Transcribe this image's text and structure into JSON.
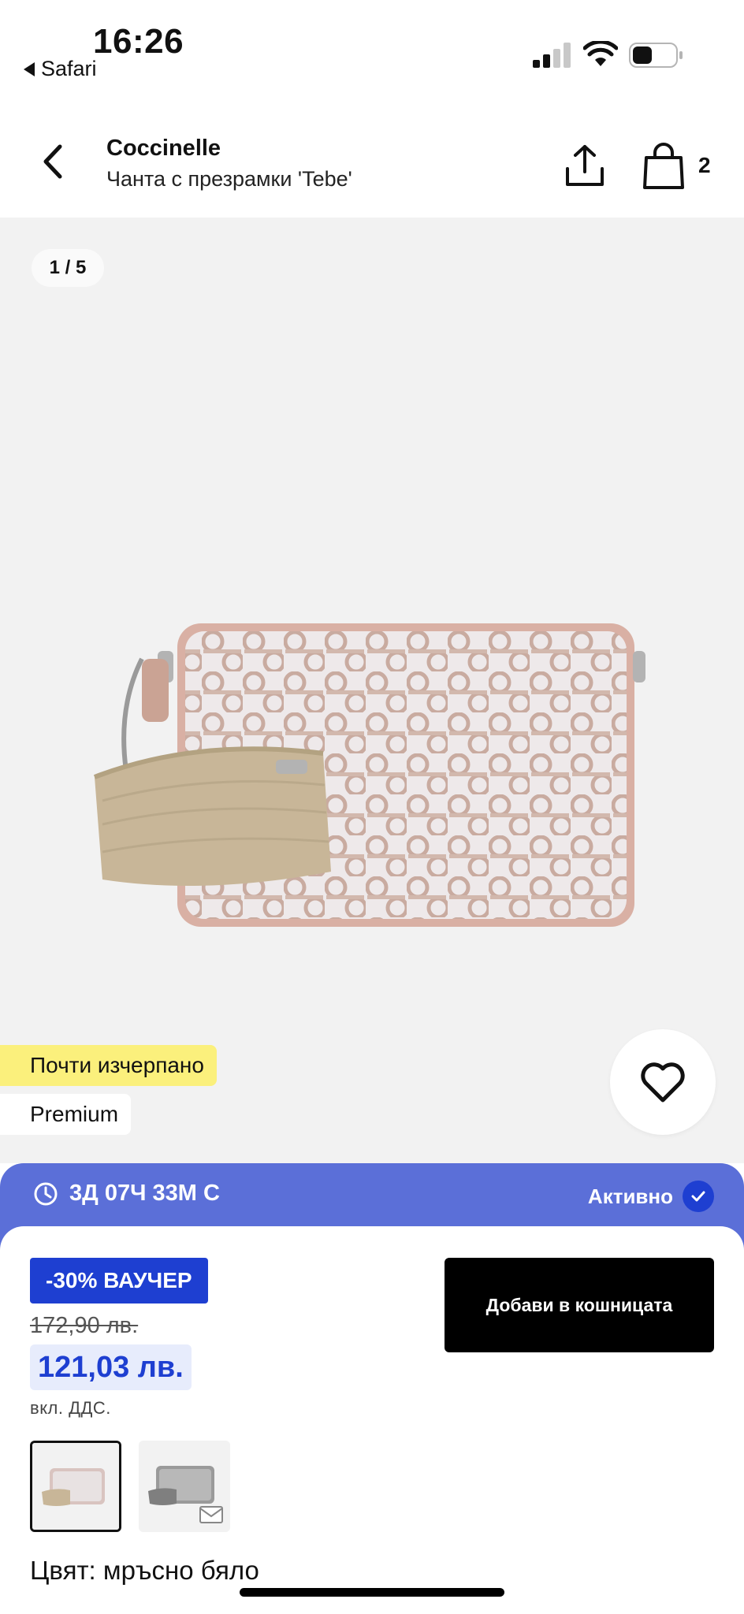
{
  "status_bar": {
    "time": "16:26",
    "back_app": "Safari"
  },
  "header": {
    "brand": "Coccinelle",
    "product_name": "Чанта с презрамки 'Tebe'",
    "bag_count": "2"
  },
  "gallery": {
    "counter": "1 / 5",
    "badges": [
      "Почти изчерпано",
      "Premium"
    ]
  },
  "promo": {
    "timer": "3Д 07Ч 33М С",
    "status": "Активно"
  },
  "pricing": {
    "voucher": "-30% ВАУЧЕР",
    "old_price": "172,90 лв.",
    "new_price": "121,03 лв.",
    "vat_note": "вкл. ДДС.",
    "add_to_cart": "Добави в кошницата"
  },
  "colors": {
    "label": "Цвят: мръсно бяло",
    "options": [
      {
        "name": "off-white",
        "selected": true
      },
      {
        "name": "grey",
        "selected": false
      }
    ]
  },
  "theme": {
    "accent": "#1e3fd1",
    "promo_strip": "#5b6fd8",
    "low_stock": "#fbf07c"
  }
}
